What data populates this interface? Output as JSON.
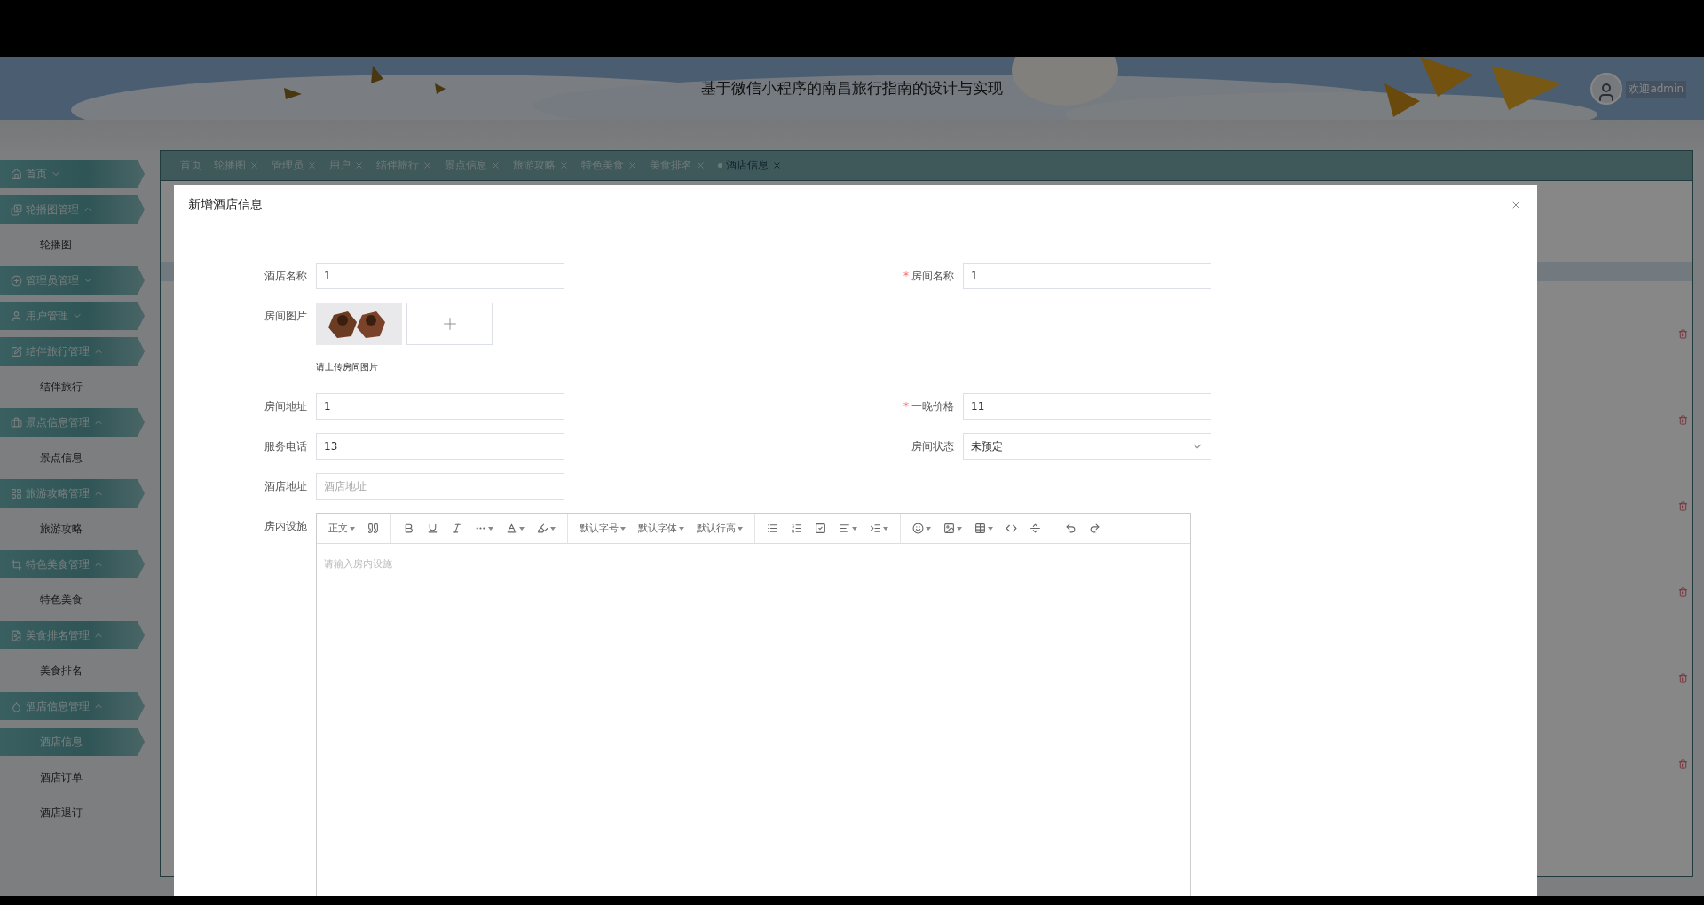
{
  "header": {
    "title": "基于微信小程序的南昌旅行指南的设计与实现",
    "welcome": "欢迎admin"
  },
  "sidebar": [
    {
      "label": "首页",
      "expanded": false
    },
    {
      "label": "轮播图管理",
      "expanded": true,
      "children": [
        {
          "label": "轮播图",
          "selected": false
        }
      ]
    },
    {
      "label": "管理员管理",
      "expanded": false
    },
    {
      "label": "用户管理",
      "expanded": false
    },
    {
      "label": "结伴旅行管理",
      "expanded": true,
      "children": [
        {
          "label": "结伴旅行",
          "selected": false
        }
      ]
    },
    {
      "label": "景点信息管理",
      "expanded": true,
      "children": [
        {
          "label": "景点信息",
          "selected": false
        }
      ]
    },
    {
      "label": "旅游攻略管理",
      "expanded": true,
      "children": [
        {
          "label": "旅游攻略",
          "selected": false
        }
      ]
    },
    {
      "label": "特色美食管理",
      "expanded": true,
      "children": [
        {
          "label": "特色美食",
          "selected": false
        }
      ]
    },
    {
      "label": "美食排名管理",
      "expanded": true,
      "children": [
        {
          "label": "美食排名",
          "selected": false
        }
      ]
    },
    {
      "label": "酒店信息管理",
      "expanded": true,
      "children": [
        {
          "label": "酒店信息",
          "selected": true
        },
        {
          "label": "酒店订单",
          "selected": false
        },
        {
          "label": "酒店退订",
          "selected": false
        }
      ]
    }
  ],
  "tabs": [
    {
      "label": "首页",
      "closable": false,
      "selected": false
    },
    {
      "label": "轮播图",
      "closable": true,
      "selected": false
    },
    {
      "label": "管理员",
      "closable": true,
      "selected": false
    },
    {
      "label": "用户",
      "closable": true,
      "selected": false
    },
    {
      "label": "结伴旅行",
      "closable": true,
      "selected": false
    },
    {
      "label": "景点信息",
      "closable": true,
      "selected": false
    },
    {
      "label": "旅游攻略",
      "closable": true,
      "selected": false
    },
    {
      "label": "特色美食",
      "closable": true,
      "selected": false
    },
    {
      "label": "美食排名",
      "closable": true,
      "selected": false
    },
    {
      "label": "酒店信息",
      "closable": true,
      "selected": true
    }
  ],
  "dialog": {
    "title": "新增酒店信息",
    "rows": [
      {
        "kind": "pair",
        "fields": [
          {
            "label": "酒店名称",
            "kind": "text",
            "value": "1"
          },
          {
            "label": "房间名称",
            "mark": "*",
            "kind": "text",
            "value": "1"
          }
        ]
      },
      {
        "kind": "upload",
        "label": "房间图片",
        "hint": "请上传房间图片"
      },
      {
        "kind": "pair",
        "fields": [
          {
            "label": "房间地址",
            "kind": "text",
            "value": "1"
          },
          {
            "label": "一晚价格",
            "mark": "*",
            "kind": "text",
            "value": "11"
          }
        ]
      },
      {
        "kind": "pair",
        "fields": [
          {
            "label": "服务电话",
            "kind": "text",
            "value": "13"
          },
          {
            "label": "房间状态",
            "kind": "select",
            "value": "未预定"
          }
        ]
      },
      {
        "kind": "pair",
        "fields": [
          {
            "label": "酒店地址",
            "kind": "text",
            "placeholder": "酒店地址"
          }
        ]
      },
      {
        "kind": "editor",
        "label": "房内设施",
        "placeholder": "请输入房内设施"
      }
    ],
    "toolbar": [
      [
        {
          "kind": "text",
          "label": "正文"
        },
        {
          "kind": "icon",
          "caret": false
        }
      ],
      [
        {
          "kind": "icon",
          "caret": false
        },
        {
          "kind": "icon",
          "caret": false
        },
        {
          "kind": "icon",
          "caret": false
        },
        {
          "kind": "icon",
          "caret": true
        },
        {
          "kind": "icon",
          "caret": true
        },
        {
          "kind": "icon",
          "caret": true
        }
      ],
      [
        {
          "kind": "text",
          "label": "默认字号"
        },
        {
          "kind": "text",
          "label": "默认字体"
        },
        {
          "kind": "text",
          "label": "默认行高"
        }
      ],
      [
        {
          "kind": "icon",
          "caret": false
        },
        {
          "kind": "icon",
          "caret": false
        },
        {
          "kind": "icon",
          "caret": false
        },
        {
          "kind": "icon",
          "caret": true
        },
        {
          "kind": "icon",
          "caret": true
        }
      ],
      [
        {
          "kind": "icon",
          "caret": true
        },
        {
          "kind": "icon",
          "caret": true
        },
        {
          "kind": "icon",
          "caret": true
        },
        {
          "kind": "icon",
          "caret": false
        },
        {
          "kind": "icon",
          "caret": false
        }
      ],
      [
        {
          "kind": "icon",
          "caret": false
        },
        {
          "kind": "icon",
          "caret": false
        }
      ]
    ]
  }
}
